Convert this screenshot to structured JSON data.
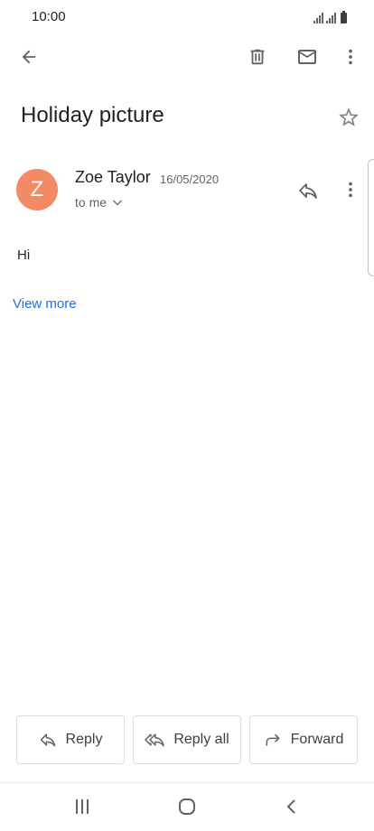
{
  "status_bar": {
    "time": "10:00"
  },
  "toolbar": {
    "back_icon": "arrow-left-icon",
    "delete_icon": "trash-icon",
    "mark_unread_icon": "mail-icon",
    "more_icon": "more-vert-icon"
  },
  "email": {
    "subject": "Holiday picture",
    "star_icon": "star-outline-icon",
    "sender": {
      "initial": "Z",
      "name": "Zoe Taylor",
      "date": "16/05/2020",
      "recipient_label": "to me",
      "avatar_color": "#f48a63"
    },
    "body": "Hi",
    "view_more_label": "View more",
    "link_color": "#1a73e8"
  },
  "actions": {
    "reply_label": "Reply",
    "reply_all_label": "Reply all",
    "forward_label": "Forward"
  },
  "nav_bar": {
    "recents_icon": "recents-icon",
    "home_icon": "home-icon",
    "back_icon": "back-chevron-icon"
  }
}
